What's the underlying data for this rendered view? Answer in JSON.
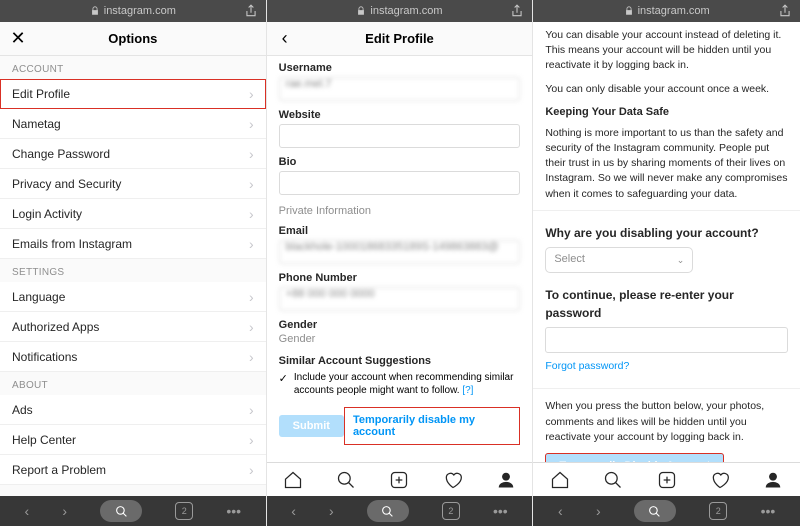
{
  "address": {
    "domain": "instagram.com"
  },
  "screen1": {
    "title": "Options",
    "sections": [
      {
        "header": "ACCOUNT",
        "items": [
          "Edit Profile",
          "Nametag",
          "Change Password",
          "Privacy and Security",
          "Login Activity",
          "Emails from Instagram"
        ]
      },
      {
        "header": "SETTINGS",
        "items": [
          "Language",
          "Authorized Apps",
          "Notifications"
        ]
      },
      {
        "header": "ABOUT",
        "items": [
          "Ads",
          "Help Center",
          "Report a Problem"
        ]
      }
    ]
  },
  "screen2": {
    "title": "Edit Profile",
    "username_label": "Username",
    "username_value": "rae.mel.7",
    "website_label": "Website",
    "bio_label": "Bio",
    "private_info": "Private Information",
    "email_label": "Email",
    "email_value": "blackhole-10001868335189S-149863883@",
    "phone_label": "Phone Number",
    "phone_value": "+88 000 000 0000",
    "gender_label": "Gender",
    "gender_placeholder": "Gender",
    "similar_label": "Similar Account Suggestions",
    "include_text": "Include your account when recommending similar accounts people might want to follow.",
    "learn_more": "[?]",
    "submit": "Submit",
    "disable_link": "Temporarily disable my account"
  },
  "screen3": {
    "p1": "You can disable your account instead of deleting it. This means your account will be hidden until you reactivate it by logging back in.",
    "p2": "You can only disable your account once a week.",
    "h": "Keeping Your Data Safe",
    "p3": "Nothing is more important to us than the safety and security of the Instagram community. People put their trust in us by sharing moments of their lives on Instagram. So we will never make any compromises when it comes to safeguarding your data.",
    "why_label": "Why are you disabling your account?",
    "select_placeholder": "Select",
    "pw_label": "To continue, please re-enter your password",
    "forgot": "Forgot password?",
    "p4": "When you press the button below, your photos, comments and likes will be hidden until you reactivate your account by logging back in.",
    "disable_btn": "Temporarily Disable Account"
  },
  "browser": {
    "tab_count": "2"
  }
}
